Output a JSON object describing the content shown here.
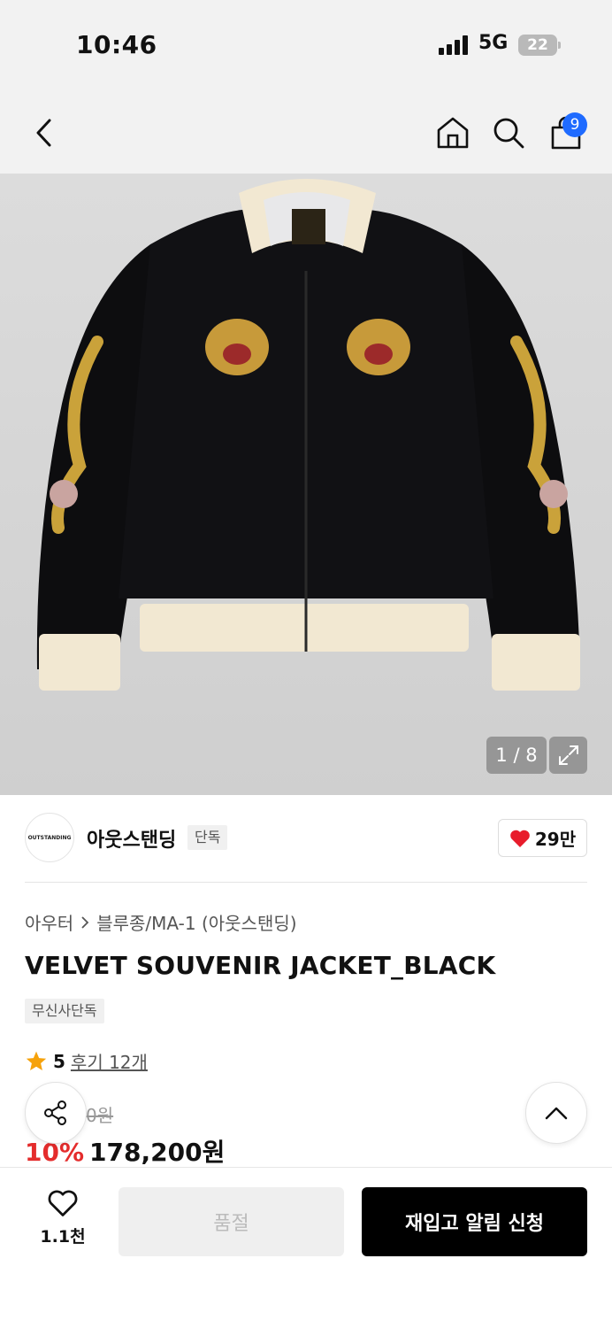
{
  "status_bar": {
    "time": "10:46",
    "network": "5G",
    "battery": "22"
  },
  "nav": {
    "cart_count": "9"
  },
  "gallery": {
    "counter": "1 / 8"
  },
  "brand": {
    "logo_text": "OUTSTANDING",
    "name": "아웃스탠딩",
    "exclusive_tag": "단독",
    "likes": "29만"
  },
  "product": {
    "breadcrumb": [
      "아우터",
      "블루종/MA-1 (아웃스탠딩)"
    ],
    "title": "VELVET SOUVENIR JACKET_BLACK",
    "tag": "무신사단독",
    "rating": "5",
    "reviews": "후기 12개",
    "original_price": "0원",
    "discount": "10%",
    "price": "178,200원"
  },
  "bottom": {
    "wish_count": "1.1천",
    "soldout_label": "품절",
    "restock_label": "재입고 알림 신청"
  },
  "colors": {
    "accent_blue": "#1f6bff",
    "discount_red": "#e42c2c",
    "heart_red": "#e81c2b",
    "star": "#f6a20b"
  }
}
